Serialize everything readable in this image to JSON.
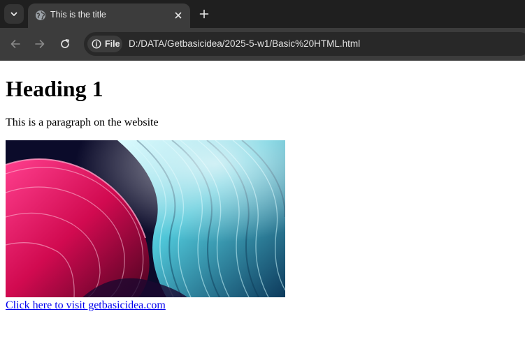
{
  "browser": {
    "tab": {
      "title": "This is the title",
      "favicon_icon": "globe-icon",
      "close_icon": "close-icon"
    },
    "tab_search_icon": "chevron-down-icon",
    "new_tab_icon": "plus-icon",
    "toolbar": {
      "back_icon": "arrow-left-icon",
      "forward_icon": "arrow-right-icon",
      "reload_icon": "reload-icon"
    },
    "omnibox": {
      "site_info_icon": "info-icon",
      "site_chip_label": "File",
      "url": "D:/DATA/Getbasicidea/2025-5-w1/Basic%20HTML.html"
    }
  },
  "page": {
    "heading": "Heading 1",
    "paragraph": "This is a paragraph on the website",
    "image": {
      "description_icon": "abstract-wave-image",
      "colors": [
        "#e0105a",
        "#1e7fa6",
        "#bdf3f7",
        "#0b0b2a"
      ]
    },
    "link_text": "Click here to visit getbasicidea.com"
  },
  "colors": {
    "tabstrip_bg": "#1f1f1f",
    "toolbar_bg": "#3c3c3c",
    "omnibox_bg": "#282828",
    "link": "#0000ee"
  }
}
